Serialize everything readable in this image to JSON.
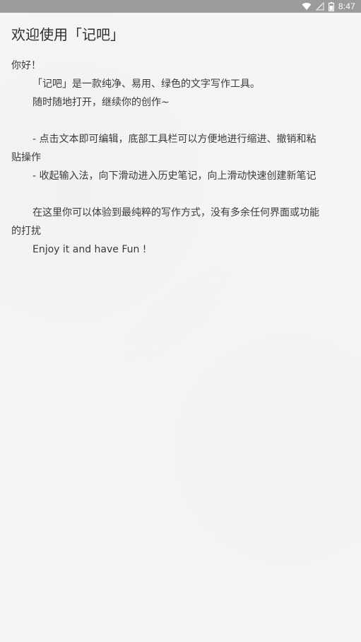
{
  "status_bar": {
    "time": "8:47",
    "icons": [
      "wifi-icon",
      "signal-icon",
      "battery-icon"
    ]
  },
  "note": {
    "title": "欢迎使用「记吧」",
    "lines": {
      "greeting": "你好！",
      "intro": "「记吧」是一款纯净、易用、绿色的文字写作工具。",
      "open_anytime": "随时随地打开，继续你的创作~",
      "tip_toolbar_a": "- 点击文本即可编辑，底部工具栏可以方便地进行缩进、撤销和粘",
      "tip_toolbar_b": "贴操作",
      "tip_gesture": "- 收起输入法，向下滑动进入历史笔记，向上滑动快速创建新笔记",
      "purest_a": "在这里你可以体验到最纯粹的写作方式，没有多余任何界面或功能",
      "purest_b": "的打扰",
      "enjoy": "Enjoy it and have Fun !"
    }
  },
  "colors": {
    "background": "#f6f6f4",
    "status_bar": "#9b9b9b",
    "text": "#3a3a3a"
  }
}
